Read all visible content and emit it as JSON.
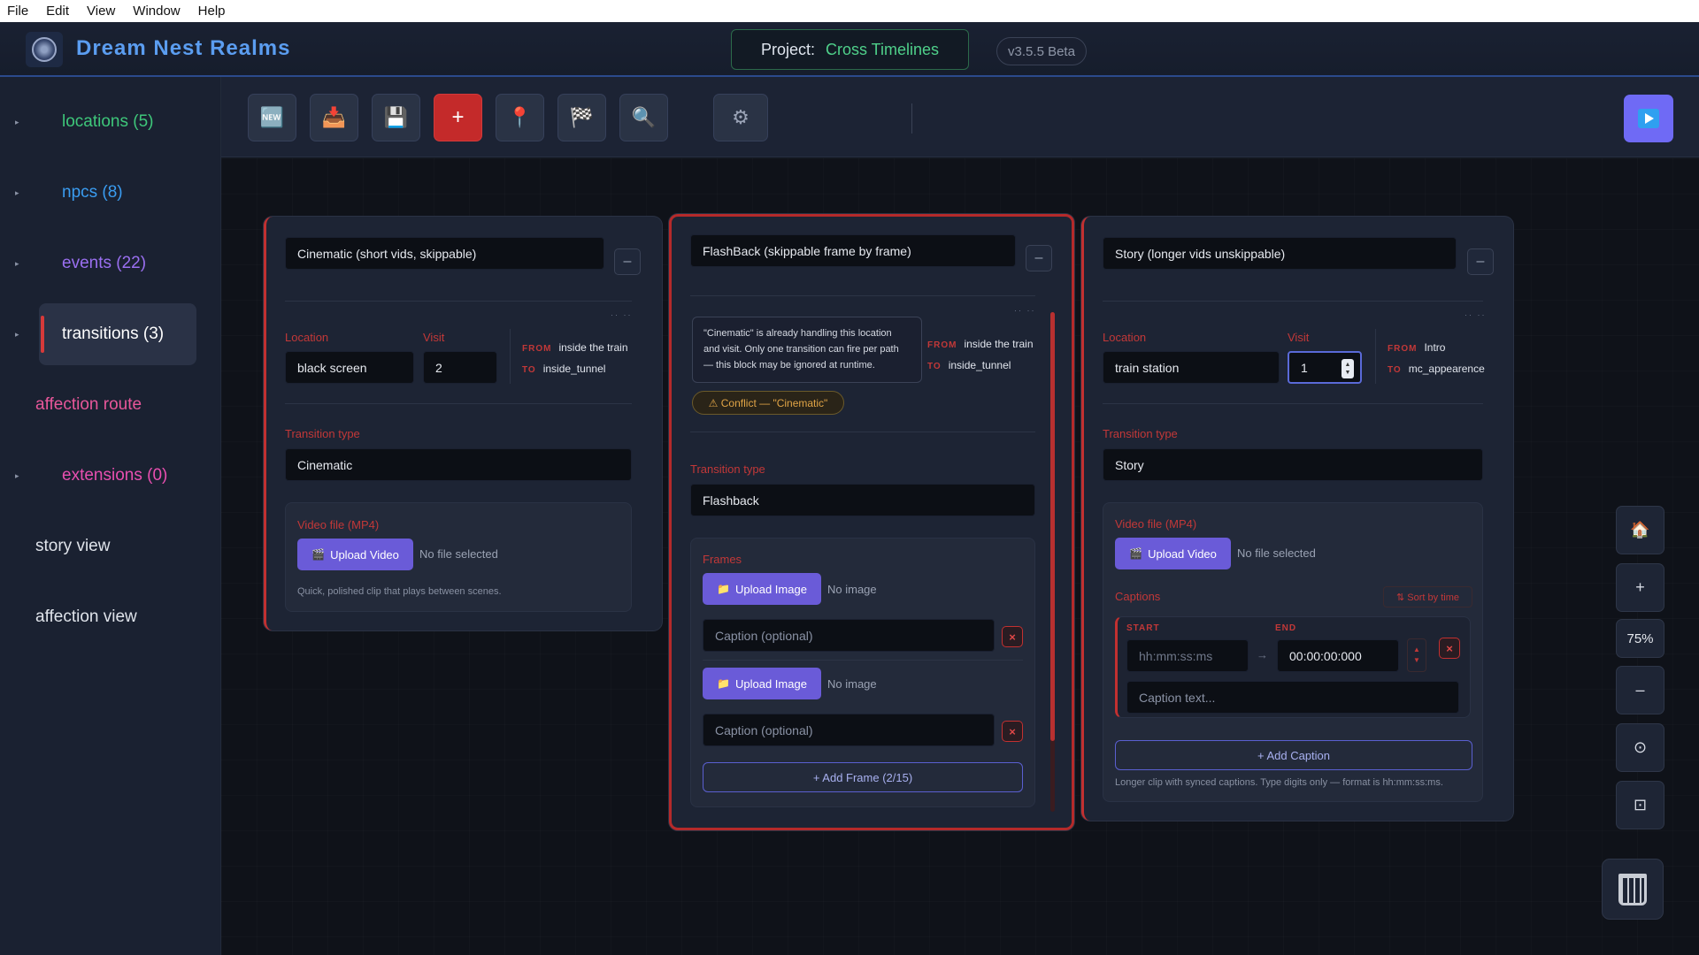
{
  "menu": [
    "File",
    "Edit",
    "View",
    "Window",
    "Help"
  ],
  "header": {
    "app_title": "Dream Nest Realms",
    "project_label": "Project:",
    "project_name": "Cross Timelines",
    "version": "v3.5.5 Beta"
  },
  "sidebar": {
    "items": [
      {
        "label": "locations (5)",
        "color": "#3ec77a",
        "arrow": true
      },
      {
        "label": "npcs (8)",
        "color": "#3a9cf0",
        "arrow": true
      },
      {
        "label": "events (22)",
        "color": "#9a6ff0",
        "arrow": true
      },
      {
        "label": "transitions (3)",
        "color": "#ffffff",
        "arrow": true,
        "active": true
      },
      {
        "label": "affection route",
        "color": "#e8579a",
        "arrow": false
      },
      {
        "label": "extensions (0)",
        "color": "#e84fb0",
        "arrow": true
      },
      {
        "label": "story view",
        "color": "#dfe3ea",
        "arrow": false
      },
      {
        "label": "affection view",
        "color": "#dfe3ea",
        "arrow": false
      }
    ],
    "arrow_glyph": "▸"
  },
  "toolbar": {
    "buttons": [
      {
        "name": "new",
        "glyph": "🆕"
      },
      {
        "name": "import",
        "glyph": "📥"
      },
      {
        "name": "save",
        "glyph": "💾"
      },
      {
        "name": "add",
        "glyph": "+"
      },
      {
        "name": "pin",
        "glyph": "📍"
      },
      {
        "name": "checker",
        "glyph": "🏁"
      },
      {
        "name": "search",
        "glyph": "🔍"
      },
      {
        "name": "settings",
        "glyph": "⚙"
      }
    ]
  },
  "cards": {
    "c1": {
      "title": "Cinematic (short vids, skippable)",
      "minus": "–",
      "dots": "·· ··",
      "location_label": "Location",
      "location_value": "black screen",
      "visit_label": "Visit",
      "visit_value": "2",
      "from_label": "FROM",
      "from_value": "inside the train",
      "to_label": "TO",
      "to_value": "inside_tunnel",
      "type_label": "Transition type",
      "type_value": "Cinematic",
      "video_label": "Video file (MP4)",
      "upload_label": "Upload Video",
      "upload_icon": "🎬",
      "no_file": "No file selected",
      "hint": "Quick, polished clip that plays between scenes."
    },
    "c2": {
      "title": "FlashBack (skippable frame by frame)",
      "minus": "–",
      "dots": "·· ··",
      "tooltip": "\"Cinematic\" is already handling this location and visit. Only one transition can fire per path — this block may be ignored at runtime.",
      "conflict": "⚠  Conflict — \"Cinematic\"",
      "from_label": "FROM",
      "from_value": "inside the train",
      "to_label": "TO",
      "to_value": "inside_tunnel",
      "type_label": "Transition type",
      "type_value": "Flashback",
      "frames_label": "Frames",
      "upload_image": "Upload Image",
      "upload_icon": "📁",
      "no_image": "No image",
      "caption_placeholder": "Caption (optional)",
      "x": "×",
      "add_frame": "+ Add Frame (2/15)"
    },
    "c3": {
      "title": "Story (longer vids unskippable)",
      "minus": "–",
      "dots": "·· ··",
      "location_label": "Location",
      "location_value": "train station",
      "visit_label": "Visit",
      "visit_value": "1",
      "from_label": "FROM",
      "from_value": "Intro",
      "to_label": "TO",
      "to_value": "mc_appearence",
      "type_label": "Transition type",
      "type_value": "Story",
      "video_label": "Video file (MP4)",
      "upload_label": "Upload Video",
      "upload_icon": "🎬",
      "no_file": "No file selected",
      "captions_label": "Captions",
      "sort_label": "⇅ Sort by time",
      "start_label": "START",
      "end_label": "END",
      "start_placeholder": "hh:mm:ss:ms",
      "arrow": "→",
      "end_value": "00:00:00:000",
      "caption_text_placeholder": "Caption text...",
      "x": "×",
      "add_caption": "+ Add Caption",
      "hint": "Longer clip with synced captions. Type digits only — format is hh:mm:ss:ms."
    }
  },
  "zoom": {
    "home": "🏠",
    "plus": "+",
    "level": "75%",
    "minus": "–",
    "center": "⊙",
    "fit": "⊡"
  }
}
